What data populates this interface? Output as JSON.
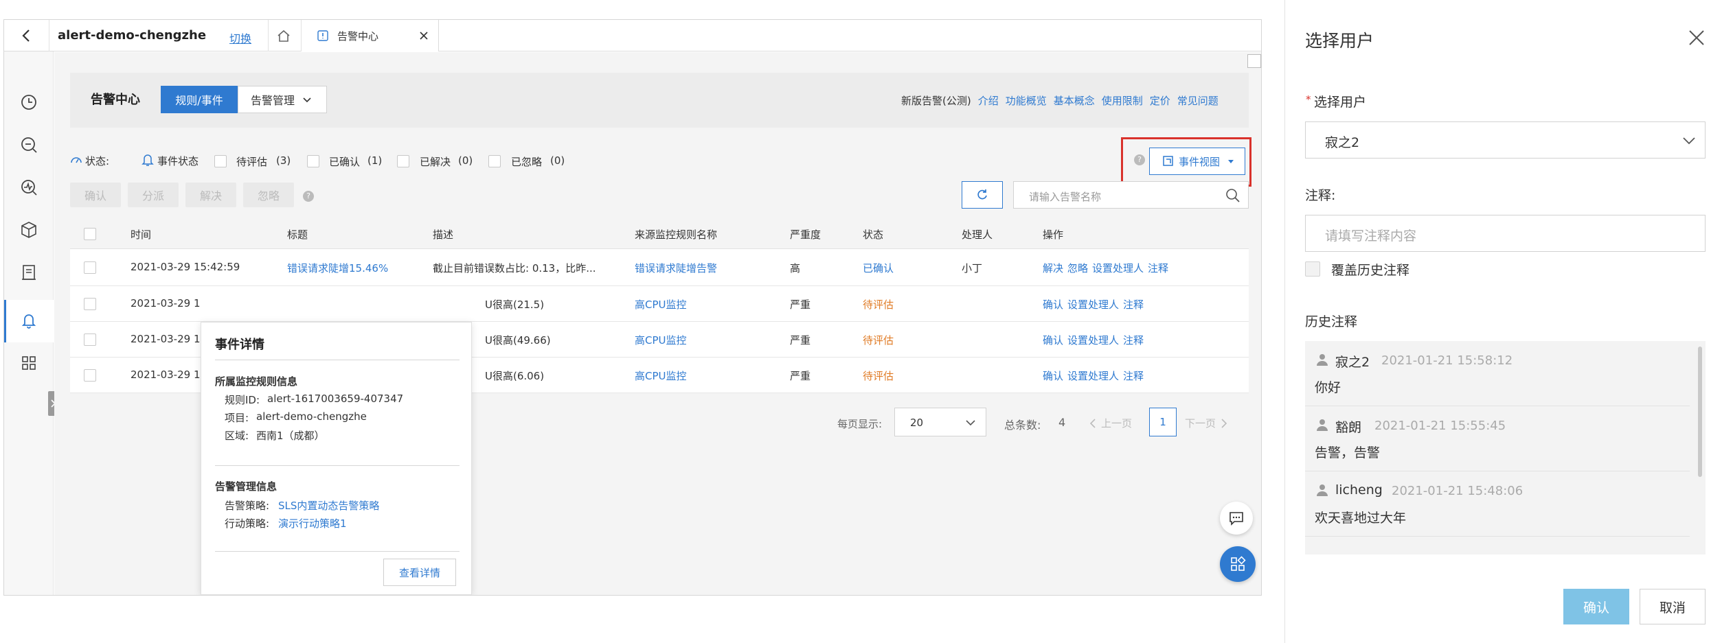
{
  "topbar": {
    "project_name": "alert-demo-chengzhe",
    "switch_label": "切换",
    "tab_label": "告警中心"
  },
  "header": {
    "title": "告警中心",
    "tab_rules_events": "规则/事件",
    "tab_alert_mgmt": "告警管理",
    "new_version_label": "新版告警(公测)",
    "links": [
      "介绍",
      "功能概览",
      "基本概念",
      "使用限制",
      "定价",
      "常见问题"
    ]
  },
  "status_filter": {
    "status_label": "状态:",
    "event_status_label": "事件状态",
    "options": [
      {
        "label": "待评估",
        "count": "(3)"
      },
      {
        "label": "已确认",
        "count": "(1)"
      },
      {
        "label": "已解决",
        "count": "(0)"
      },
      {
        "label": "已忽略",
        "count": "(0)"
      }
    ],
    "event_view_label": "事件视图"
  },
  "actions": {
    "confirm": "确认",
    "dispatch": "分派",
    "resolve": "解决",
    "ignore": "忽略",
    "search_placeholder": "请输入告警名称"
  },
  "table": {
    "headers": [
      "时间",
      "标题",
      "描述",
      "来源监控规则名称",
      "严重度",
      "状态",
      "处理人",
      "操作"
    ],
    "rows": [
      {
        "time": "2021-03-29 15:42:59",
        "title": "错误请求陡增15.46%",
        "desc": "截止目前错误数占比: 0.13，比昨...",
        "rule": "错误请求陡增告警",
        "severity": "高",
        "status": "已确认",
        "handler": "小丁",
        "ops": [
          "解决",
          "忽略",
          "设置处理人",
          "注释"
        ]
      },
      {
        "time": "2021-03-29 1",
        "title": "",
        "desc": "U很高(21.5)",
        "rule": "高CPU监控",
        "severity": "严重",
        "status": "待评估",
        "handler": "",
        "ops": [
          "确认",
          "设置处理人",
          "注释"
        ]
      },
      {
        "time": "2021-03-29 1",
        "title": "",
        "desc": "U很高(49.66)",
        "rule": "高CPU监控",
        "severity": "严重",
        "status": "待评估",
        "handler": "",
        "ops": [
          "确认",
          "设置处理人",
          "注释"
        ]
      },
      {
        "time": "2021-03-29 1",
        "title": "",
        "desc": "U很高(6.06)",
        "rule": "高CPU监控",
        "severity": "严重",
        "status": "待评估",
        "handler": "",
        "ops": [
          "确认",
          "设置处理人",
          "注释"
        ]
      }
    ]
  },
  "pagination": {
    "per_page_label": "每页显示:",
    "per_page_value": "20",
    "total_label": "总条数:",
    "total_value": "4",
    "prev": "上一页",
    "current": "1",
    "next": "下一页"
  },
  "popover": {
    "title": "事件详情",
    "rule_section": "所属监控规则信息",
    "rule_id_label": "规则ID:",
    "rule_id": "alert-1617003659-407347",
    "project_label": "项目:",
    "project": "alert-demo-chengzhe",
    "region_label": "区域:",
    "region": "西南1（成都）",
    "mgmt_section": "告警管理信息",
    "policy_label": "告警策略:",
    "policy": "SLS内置动态告警策略",
    "action_label": "行动策略:",
    "action": "演示行动策略1",
    "details_button": "查看详情"
  },
  "panel": {
    "title": "选择用户",
    "required_mark": "*",
    "select_user_label": "选择用户",
    "selected_user": "寂之2",
    "note_label": "注释:",
    "note_placeholder": "请填写注释内容",
    "overwrite_label": "覆盖历史注释",
    "history_label": "历史注释",
    "history": [
      {
        "user": "寂之2",
        "time": "2021-01-21 15:58:12",
        "text": "你好"
      },
      {
        "user": "豁朗",
        "time": "2021-01-21 15:55:45",
        "text": "告警，告警"
      },
      {
        "user": "licheng",
        "time": "2021-01-21 15:48:06",
        "text": "欢天喜地过大年"
      }
    ],
    "confirm_button": "确认",
    "cancel_button": "取消"
  },
  "colors": {
    "primary": "#2f7ad0",
    "warning": "#e07b25",
    "highlight_box": "#d9322c",
    "confirm_button": "#7fc3e6",
    "fab": "#2f7ad0"
  }
}
